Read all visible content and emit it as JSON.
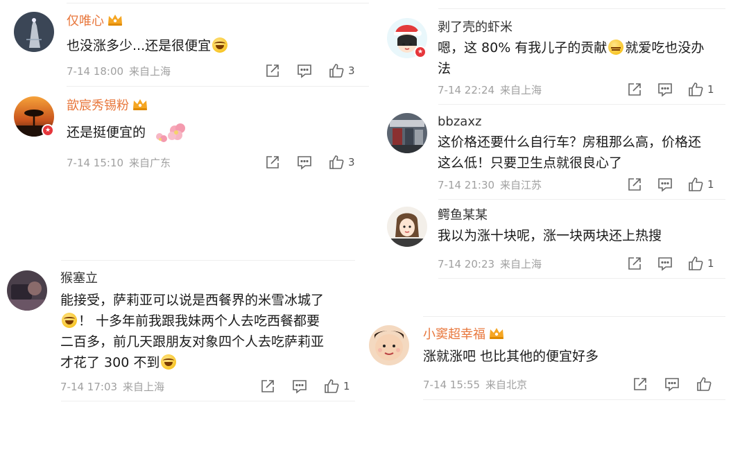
{
  "comments": [
    {
      "username": "仅唯心",
      "text": "也没涨多少...还是很便宜",
      "date": "7-14 18:00",
      "location": "来自上海",
      "likes": "3"
    },
    {
      "username": "歆宸秀锡粉",
      "text": "还是挺便宜的",
      "date": "7-14 15:10",
      "location": "来自广东",
      "likes": "3"
    },
    {
      "username": "猴塞立",
      "text_lines": [
        "能接受，萨莉亚可以说是西餐界的米雪冰城了",
        "！ 十多年前我跟我妹两个人去吃西餐都要",
        "二百多，前几天跟朋友对象四个人去吃萨莉亚",
        "才花了 300 不到"
      ],
      "date": "7-14 17:03",
      "location": "来自上海",
      "likes": "1"
    },
    {
      "username": "剥了壳的虾米",
      "text_lines": [
        "嗯，这 80% 有我儿子的贡献",
        "就爱吃也没办",
        "法"
      ],
      "date": "7-14 22:24",
      "location": "来自上海",
      "likes": "1"
    },
    {
      "username": "bbzaxz",
      "text_lines": [
        "这价格还要什么自行车？房租那么高，价格还",
        "这么低！只要卫生点就很良心了"
      ],
      "date": "7-14 21:30",
      "location": "来自江苏",
      "likes": "1"
    },
    {
      "username": "鳄鱼某某",
      "text": "我以为涨十块呢，涨一块两块还上热搜",
      "date": "7-14 20:23",
      "location": "来自上海",
      "likes": "1"
    },
    {
      "username": "小窦超幸福",
      "text": "涨就涨吧 也比其他的便宜好多",
      "date": "7-14 15:55",
      "location": "来自北京",
      "likes": ""
    }
  ],
  "icons": [
    "share-icon",
    "comment-icon",
    "thumbs-up-icon",
    "crown-icon",
    "verified-badge-icon"
  ],
  "colors": {
    "vip_name": "#e8773c",
    "normal_name": "#333333",
    "meta": "#a0a0a0",
    "badge": "#e6363b"
  }
}
